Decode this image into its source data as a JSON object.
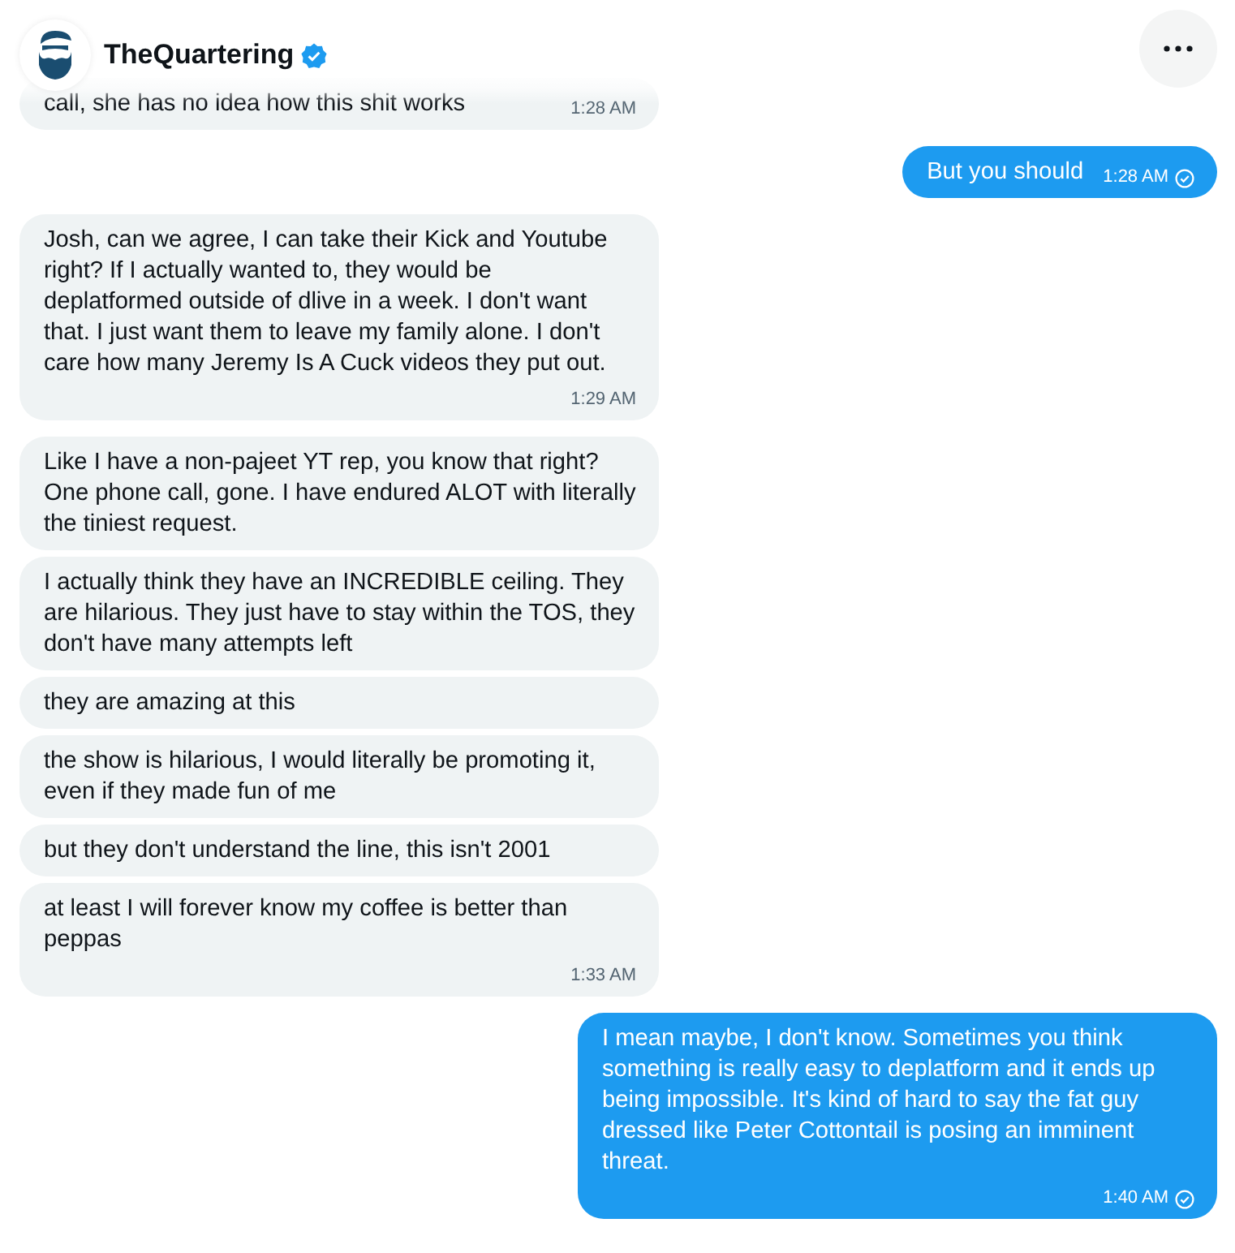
{
  "header": {
    "name": "TheQuartering",
    "verified": true
  },
  "messages": [
    {
      "kind": "received",
      "text": "call, she has no idea how this shit works",
      "time": "1:28 AM"
    },
    {
      "kind": "sent",
      "text": "But you should",
      "time": "1:28 AM"
    },
    {
      "kind": "received",
      "text": "Josh, can we agree, I can take their Kick and Youtube right?  If I actually wanted to, they would be deplatformed outside of dlive in a week.   I don't want that.  I just want them to leave my family alone.  I don't care how many Jeremy Is A Cuck videos they put out.",
      "time": "1:29 AM"
    },
    {
      "kind": "received",
      "text": "Like I have a non-pajeet YT rep, you know that right? One phone call, gone.  I have endured ALOT with literally the tiniest request."
    },
    {
      "kind": "received",
      "text": "I actually think they have an INCREDIBLE ceiling.  They are hilarious.  They just have to stay within the TOS, they don't have many attempts left"
    },
    {
      "kind": "received",
      "text": "they are amazing at this"
    },
    {
      "kind": "received",
      "text": "the show is hilarious, I would literally be promoting it, even if they made fun of me"
    },
    {
      "kind": "received",
      "text": "but they don't understand the line, this isn't 2001"
    },
    {
      "kind": "received",
      "text": "at least I will forever know my coffee is better than peppas",
      "time": "1:33 AM"
    },
    {
      "kind": "sent",
      "text": "I mean maybe, I don't know. Sometimes you think something is really easy to deplatform and it ends up being impossible. It's kind of hard to say the fat guy dressed like Peter Cottontail is posing an imminent threat.",
      "time": "1:40 AM"
    }
  ]
}
